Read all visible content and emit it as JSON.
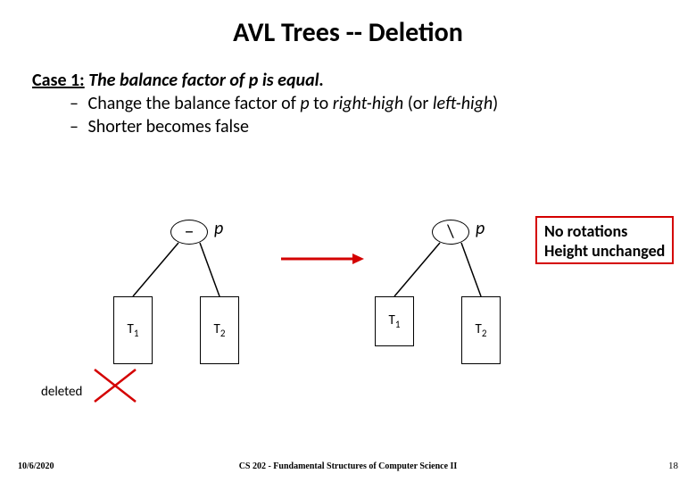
{
  "title": "AVL Trees -- Deletion",
  "case": {
    "label": "Case 1:",
    "desc": "The balance factor of p is equal."
  },
  "bullets": {
    "b1_pre": "Change the balance factor of ",
    "b1_p": "p",
    "b1_mid": " to ",
    "b1_rh": "right-high",
    "b1_or": " (or ",
    "b1_lh": "left-high",
    "b1_end": ")",
    "b2": "Shorter becomes false"
  },
  "left": {
    "oval": "–",
    "p": "p",
    "t1": "T",
    "t1_sub": "1",
    "t2": "T",
    "t2_sub": "2"
  },
  "right": {
    "oval": "\\",
    "p": "p",
    "t1": "T",
    "t1_sub": "1",
    "t2": "T",
    "t2_sub": "2"
  },
  "note": {
    "line1": "No rotations",
    "line2": "Height unchanged"
  },
  "deleted": "deleted",
  "footer": {
    "date": "10/6/2020",
    "center": "CS 202 - Fundamental Structures of Computer Science II",
    "page": "18"
  }
}
